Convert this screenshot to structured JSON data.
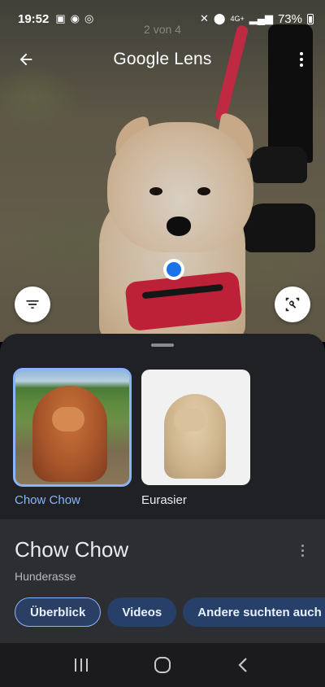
{
  "status_bar": {
    "time": "19:52",
    "battery_pct": "73%",
    "network": "4G+"
  },
  "page_indicator": "2 von 4",
  "app_bar": {
    "title": "Google Lens"
  },
  "results": [
    {
      "label": "Chow Chow",
      "selected": true
    },
    {
      "label": "Eurasier",
      "selected": false
    }
  ],
  "info": {
    "title": "Chow Chow",
    "subtitle": "Hunderasse"
  },
  "chips": [
    {
      "label": "Überblick",
      "active": true
    },
    {
      "label": "Videos",
      "active": false
    },
    {
      "label": "Andere suchten auch nach",
      "active": false
    }
  ],
  "colors": {
    "accent": "#8ab4f8",
    "sheet_bg": "#202124",
    "info_bg": "#2d2e31",
    "chip_bg": "#27406a",
    "dot_blue": "#1a73e8"
  }
}
